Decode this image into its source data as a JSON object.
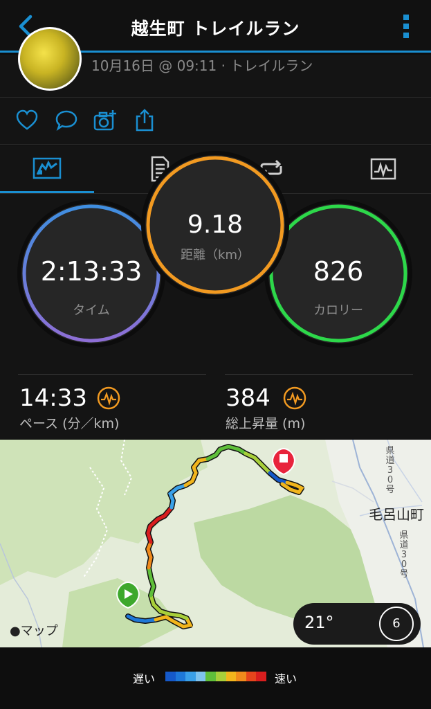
{
  "header": {
    "title": "越生町 トレイルラン",
    "accent": "#1a8fd1"
  },
  "activity": {
    "date_line": "10月16日 @ 09:11 · トレイルラン"
  },
  "actions": [
    "heart-icon",
    "comment-icon",
    "add-photo-icon",
    "share-icon"
  ],
  "tabs": [
    "overview-tab",
    "details-tab",
    "laps-tab",
    "graphs-tab"
  ],
  "stats": {
    "time": {
      "value": "2:13:33",
      "label": "タイム",
      "color": "#6f7fd6"
    },
    "distance": {
      "value": "9.18",
      "label": "距離（km）",
      "color": "#f29a21"
    },
    "calories": {
      "value": "826",
      "label": "カロリー",
      "color": "#2dd84a"
    }
  },
  "metrics": {
    "pace": {
      "value": "14:33",
      "label": "ペース (分／km)"
    },
    "ascent": {
      "value": "384",
      "label": "総上昇量 (m)"
    }
  },
  "map": {
    "provider_label": "マップ",
    "town_label": "毛呂山町",
    "road_label_1": [
      "県",
      "道",
      "3",
      "0",
      "号"
    ],
    "road_label_2": [
      "県",
      "道",
      "3",
      "0",
      "号"
    ],
    "temperature": "21°",
    "wind": "6"
  },
  "legend": {
    "slow": "遅い",
    "fast": "速い",
    "colors": [
      "#1559c9",
      "#1e78d8",
      "#3aa0e8",
      "#7fc3ee",
      "#5fbf3a",
      "#a8cf3a",
      "#f2b51c",
      "#f08a1c",
      "#e6451c",
      "#d91e1e"
    ]
  }
}
